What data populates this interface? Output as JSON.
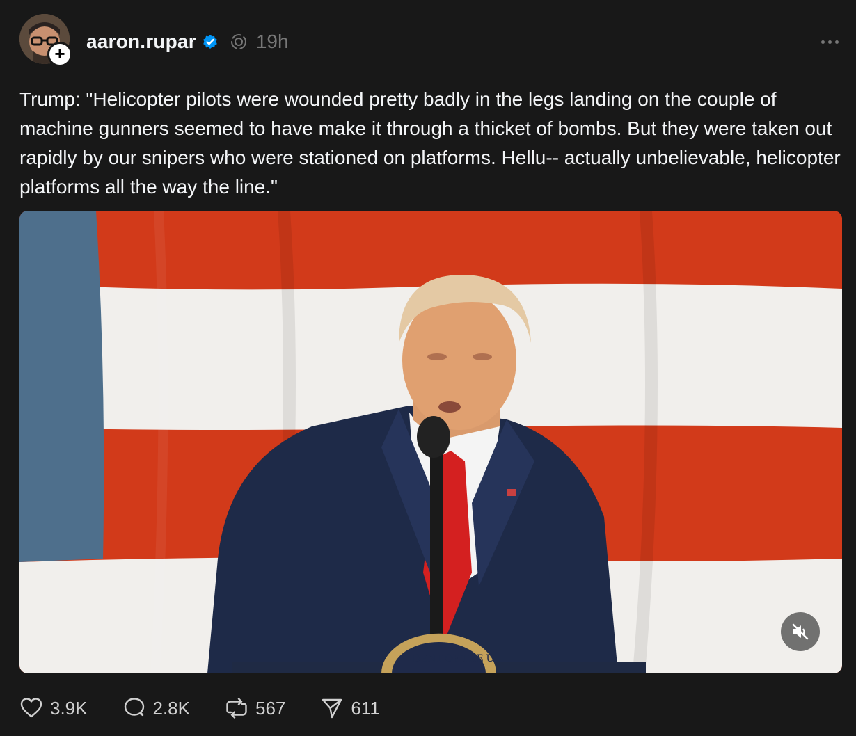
{
  "post": {
    "username": "aaron.rupar",
    "timestamp": "19h",
    "text": "Trump: \"Helicopter pilots were wounded pretty badly in the legs landing on the couple of machine gunners seemed to have make it through a thicket of bombs. But they were taken out rapidly by our snipers who were stationed on platforms. Hellu-- actually unbelievable, helicopter platforms all the way the line.\"",
    "media_seal_text": "DENT OF THE U",
    "icons": {
      "avatar": "avatar",
      "follow": "plus-icon",
      "verified": "verified-badge-icon",
      "thread": "thread-spiral-icon",
      "more": "more-horizontal-icon",
      "mute": "volume-muted-icon",
      "like": "heart-icon",
      "reply": "comment-icon",
      "repost": "repost-icon",
      "share": "send-icon"
    }
  },
  "actions": {
    "likes": "3.9K",
    "replies": "2.8K",
    "reposts": "567",
    "shares": "611"
  },
  "colors": {
    "background": "#181818",
    "text": "#f3f5f7",
    "muted": "#777777",
    "verified": "#0095f6",
    "flag_red": "#d23a1a",
    "flag_white": "#f1efec",
    "flag_blue": "#4e6f8c"
  }
}
